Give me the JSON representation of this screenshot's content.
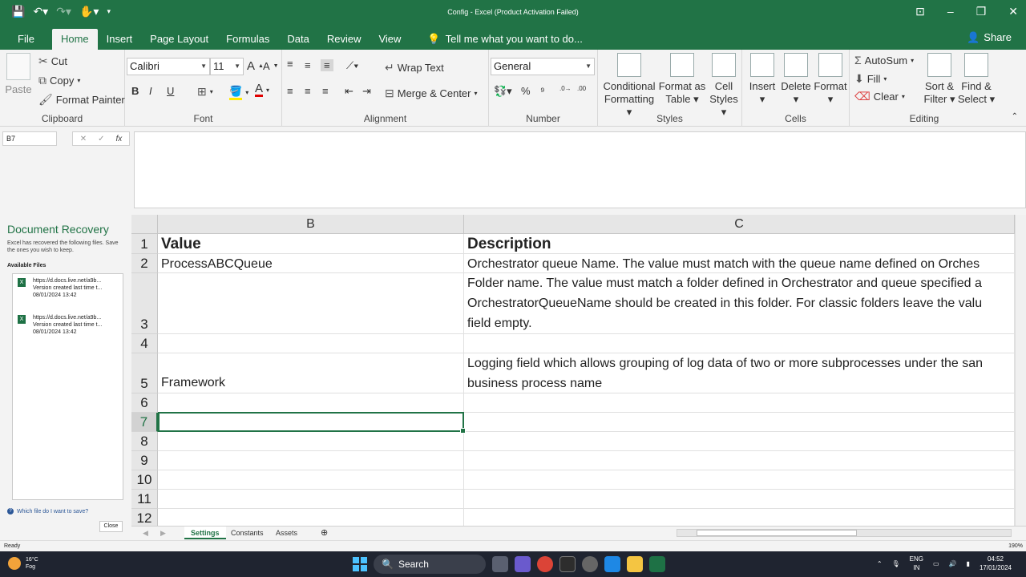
{
  "window": {
    "title": "Config - Excel (Product Activation Failed)"
  },
  "tabs": [
    "File",
    "Home",
    "Insert",
    "Page Layout",
    "Formulas",
    "Data",
    "Review",
    "View"
  ],
  "tell_me": "Tell me what you want to do...",
  "share": "Share",
  "ribbon": {
    "clipboard": {
      "paste": "Paste",
      "cut": "Cut",
      "copy": "Copy",
      "format_painter": "Format Painter",
      "label": "Clipboard"
    },
    "font": {
      "name": "Calibri",
      "size": "11",
      "label": "Font",
      "bold": "B",
      "italic": "I",
      "underline": "U"
    },
    "alignment": {
      "wrap_text": "Wrap Text",
      "merge_center": "Merge & Center",
      "label": "Alignment"
    },
    "number": {
      "format": "General",
      "label": "Number",
      "percent": "%",
      "comma": "⁹"
    },
    "styles": {
      "conditional": "Conditional",
      "conditional2": "Formatting",
      "format_as": "Format as",
      "format_as2": "Table",
      "cell": "Cell",
      "cell2": "Styles",
      "label": "Styles"
    },
    "cells": {
      "insert": "Insert",
      "delete": "Delete",
      "format": "Format",
      "label": "Cells"
    },
    "editing": {
      "autosum": "AutoSum",
      "fill": "Fill",
      "clear": "Clear",
      "sort": "Sort &",
      "sort2": "Filter",
      "find": "Find &",
      "find2": "Select",
      "label": "Editing"
    }
  },
  "formula_bar": {
    "name_box": "B7",
    "fx": "fx"
  },
  "recovery": {
    "title": "Document Recovery",
    "description": "Excel has recovered the following files. Save the ones you wish to keep.",
    "available": "Available Files",
    "files": [
      {
        "name": "https://d.docs.live.net/a9b...",
        "note": "Version created last time t...",
        "date": "08/01/2024 13:42"
      },
      {
        "name": "https://d.docs.live.net/a9b...",
        "note": "Version created last time t...",
        "date": "08/01/2024 13:42"
      }
    ],
    "which_file": "Which file do I want to save?",
    "close": "Close"
  },
  "grid": {
    "columns": [
      "B",
      "C"
    ],
    "rows": [
      "1",
      "2",
      "3",
      "4",
      "5",
      "6",
      "7",
      "8",
      "9",
      "10",
      "11",
      "12"
    ],
    "cells": {
      "b1": "Value",
      "c1": "Description",
      "b2": "ProcessABCQueue",
      "c2": "Orchestrator queue Name. The value must match with the queue name defined on Orches",
      "c3": "Folder name. The value must match a folder defined in Orchestrator and queue specified a\nOrchestratorQueueName should be created in this folder. For classic folders leave the valu\nfield empty.",
      "b5": "Framework",
      "c5": "Logging field which allows grouping of log data of two or more subprocesses under the san\nbusiness process name"
    }
  },
  "sheets": [
    "Settings",
    "Constants",
    "Assets"
  ],
  "status": {
    "ready": "Ready",
    "zoom": "190%"
  },
  "taskbar": {
    "temp": "16°C",
    "weather": "Fog",
    "search": "Search",
    "lang": "ENG",
    "lang2": "IN",
    "time": "04:52",
    "date": "17/01/2024"
  }
}
